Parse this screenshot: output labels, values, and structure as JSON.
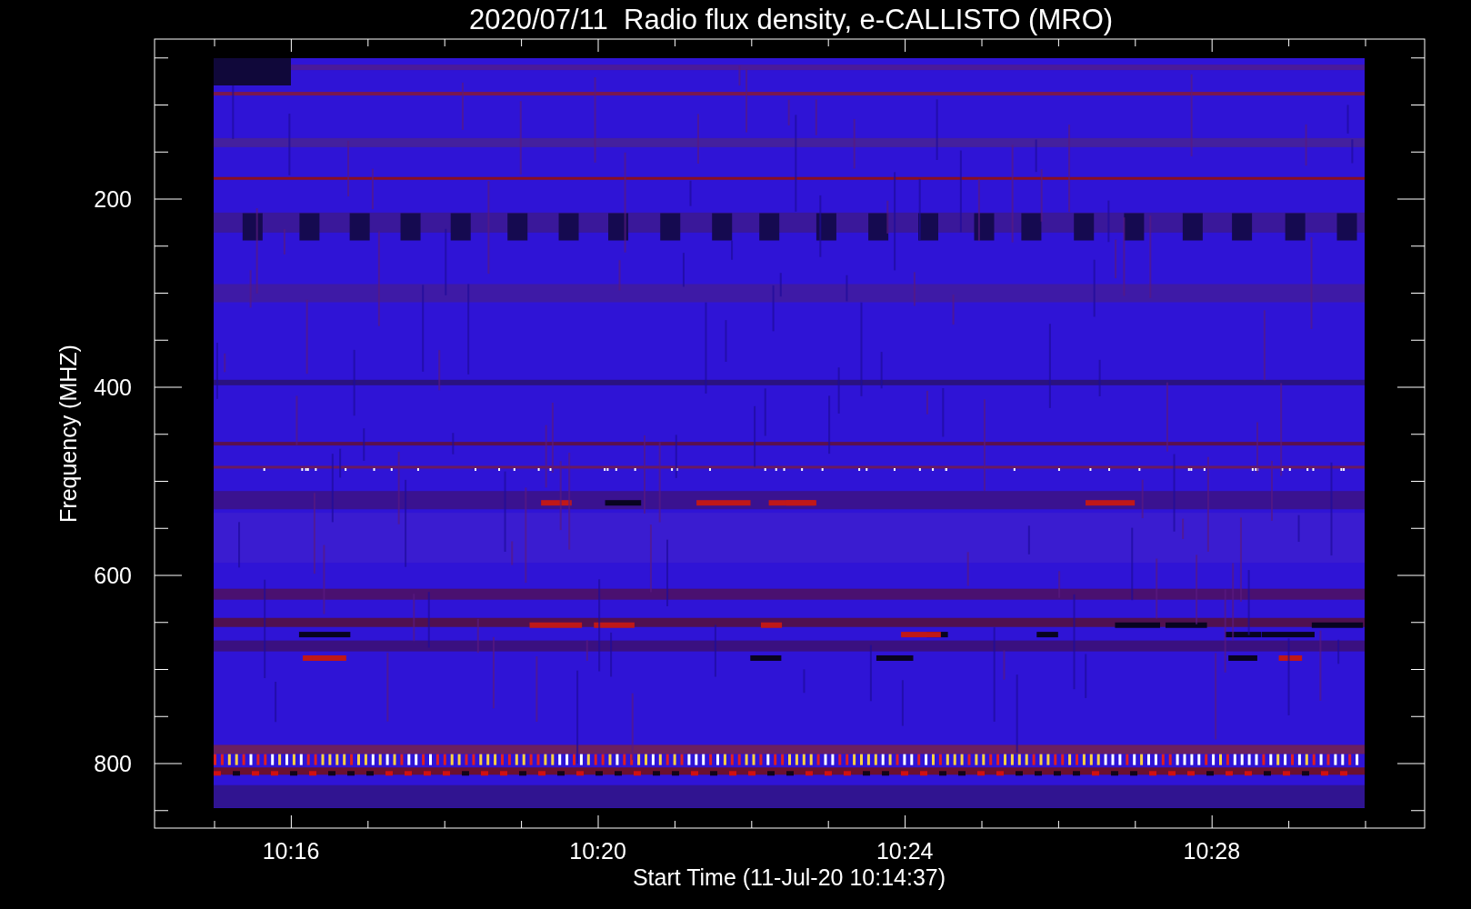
{
  "title": "2020/07/11  Radio flux density, e-CALLISTO (MRO)",
  "y_axis": {
    "label": "Frequency (MHZ)",
    "ticks": [
      "200",
      "400",
      "600",
      "800"
    ]
  },
  "x_axis": {
    "label": "Start Time (11-Jul-20 10:14:37)",
    "ticks": [
      "10:16",
      "10:20",
      "10:24",
      "10:28"
    ]
  }
}
